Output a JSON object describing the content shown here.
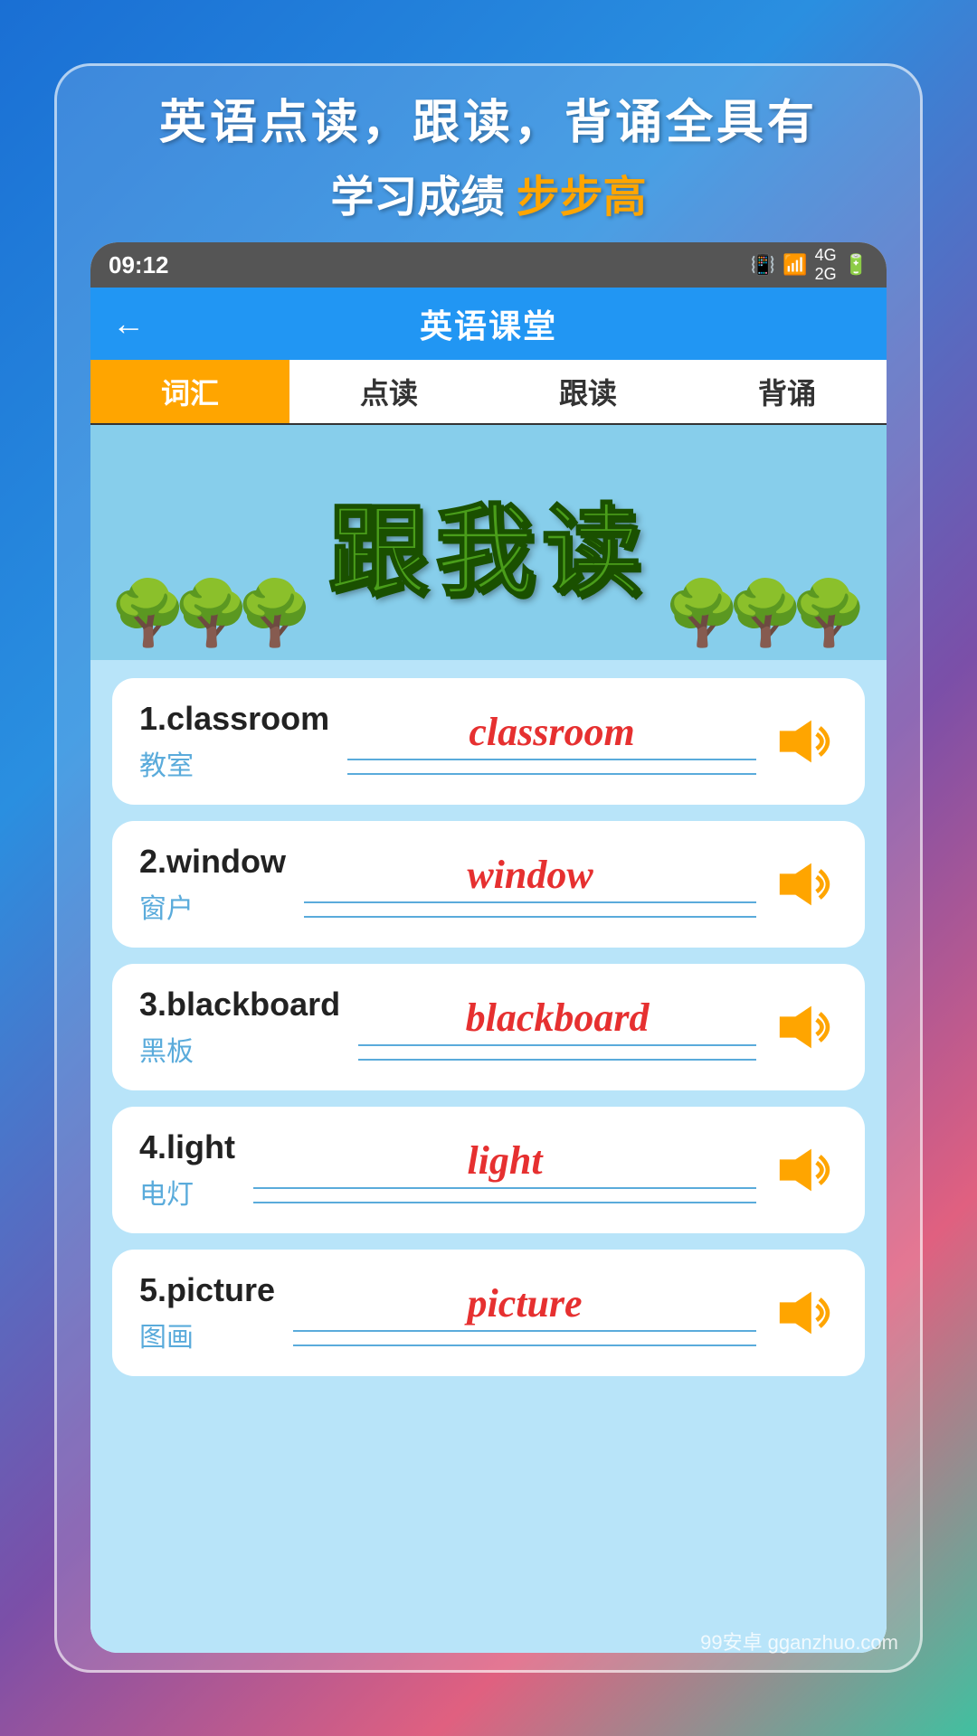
{
  "promo": {
    "line1": "英语点读，跟读，背诵全具有",
    "line2_prefix": "学习成绩",
    "line2_highlight": "步步高"
  },
  "statusBar": {
    "time": "09:12",
    "icons": [
      "vibrate",
      "wifi",
      "signal-4g",
      "battery"
    ]
  },
  "header": {
    "back_label": "←",
    "title": "英语课堂"
  },
  "tabs": [
    {
      "id": "vocabulary",
      "label": "词汇",
      "active": true
    },
    {
      "id": "reading",
      "label": "点读",
      "active": false
    },
    {
      "id": "follow",
      "label": "跟读",
      "active": false
    },
    {
      "id": "recite",
      "label": "背诵",
      "active": false
    }
  ],
  "banner": {
    "text": "跟我读"
  },
  "words": [
    {
      "number": "1",
      "english": "classroom",
      "chinese": "教室",
      "display": "classroom"
    },
    {
      "number": "2",
      "english": "window",
      "chinese": "窗户",
      "display": "window"
    },
    {
      "number": "3",
      "english": "blackboard",
      "chinese": "黑板",
      "display": "blackboard"
    },
    {
      "number": "4",
      "english": "light",
      "chinese": "电灯",
      "display": "light"
    },
    {
      "number": "5",
      "english": "picture",
      "chinese": "图画",
      "display": "picture"
    }
  ],
  "watermark": "99安卓 gganzhuo.com"
}
